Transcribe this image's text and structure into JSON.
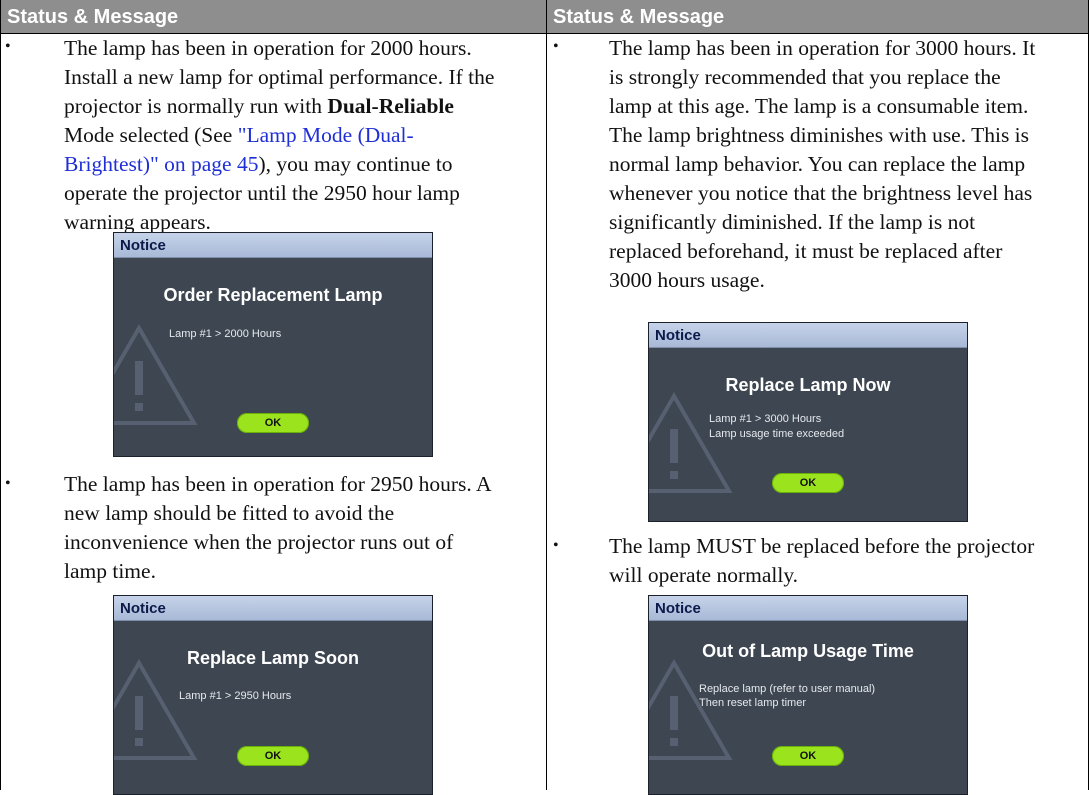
{
  "headers": {
    "left": "Status & Message",
    "right": "Status & Message"
  },
  "left": {
    "item1": {
      "line1": "The lamp has been in operation for 2000 hours.",
      "line2": "Install a new lamp for optimal performance. If the",
      "line3_pre": "projector is normally run with ",
      "line3_bold": "Dual-Reliable",
      "line4": "Mode selected (See ",
      "line4_link": "\"Lamp Mode (Dual-",
      "line5_link": "Brightest)\" on page 45",
      "line5_post": "), you may continue to",
      "line6": "operate the projector until the 2950 hour lamp",
      "line7": "warning appears."
    },
    "dialog1": {
      "header": "Notice",
      "title": "Order Replacement Lamp",
      "lines": [
        "Lamp #1 > 2000 Hours"
      ],
      "ok": "OK"
    },
    "item2": {
      "line1": "The lamp has been in operation for 2950 hours. A",
      "line2": "new lamp should be fitted to avoid the",
      "line3": "inconvenience when the projector runs out of",
      "line4": "lamp time."
    },
    "dialog2": {
      "header": "Notice",
      "title": "Replace Lamp Soon",
      "lines": [
        "Lamp #1 > 2950 Hours"
      ],
      "ok": "OK"
    }
  },
  "right": {
    "item1": {
      "line1": "The lamp has been in operation for 3000 hours. It",
      "line2": "is strongly recommended that you replace the",
      "line3": "lamp at this age. The lamp is a consumable item.",
      "line4": "The lamp brightness diminishes with use. This is",
      "line5": "normal lamp behavior. You can replace the lamp",
      "line6": "whenever you notice that the brightness level has",
      "line7": "significantly diminished. If the lamp is not",
      "line8": "replaced beforehand, it must be replaced after",
      "line9": "3000 hours usage."
    },
    "dialog1": {
      "header": "Notice",
      "title": "Replace Lamp Now",
      "lines": [
        "Lamp #1 > 3000 Hours",
        "Lamp usage time exceeded"
      ],
      "ok": "OK"
    },
    "item2": {
      "line1": "The lamp MUST be replaced before the projector",
      "line2": "will operate normally."
    },
    "dialog2": {
      "header": "Notice",
      "title": "Out of Lamp Usage Time",
      "lines": [
        "Replace lamp (refer to user manual)",
        "Then reset lamp timer"
      ],
      "ok": "OK"
    }
  },
  "bullet": "•",
  "icons": {
    "dialog_background": "warning-triangle-icon"
  },
  "colors": {
    "header_bg": "#8e8e8e",
    "link": "#1f2fd6",
    "dialog_bg": "#3d4651",
    "ok_button": "#9ae31d"
  }
}
